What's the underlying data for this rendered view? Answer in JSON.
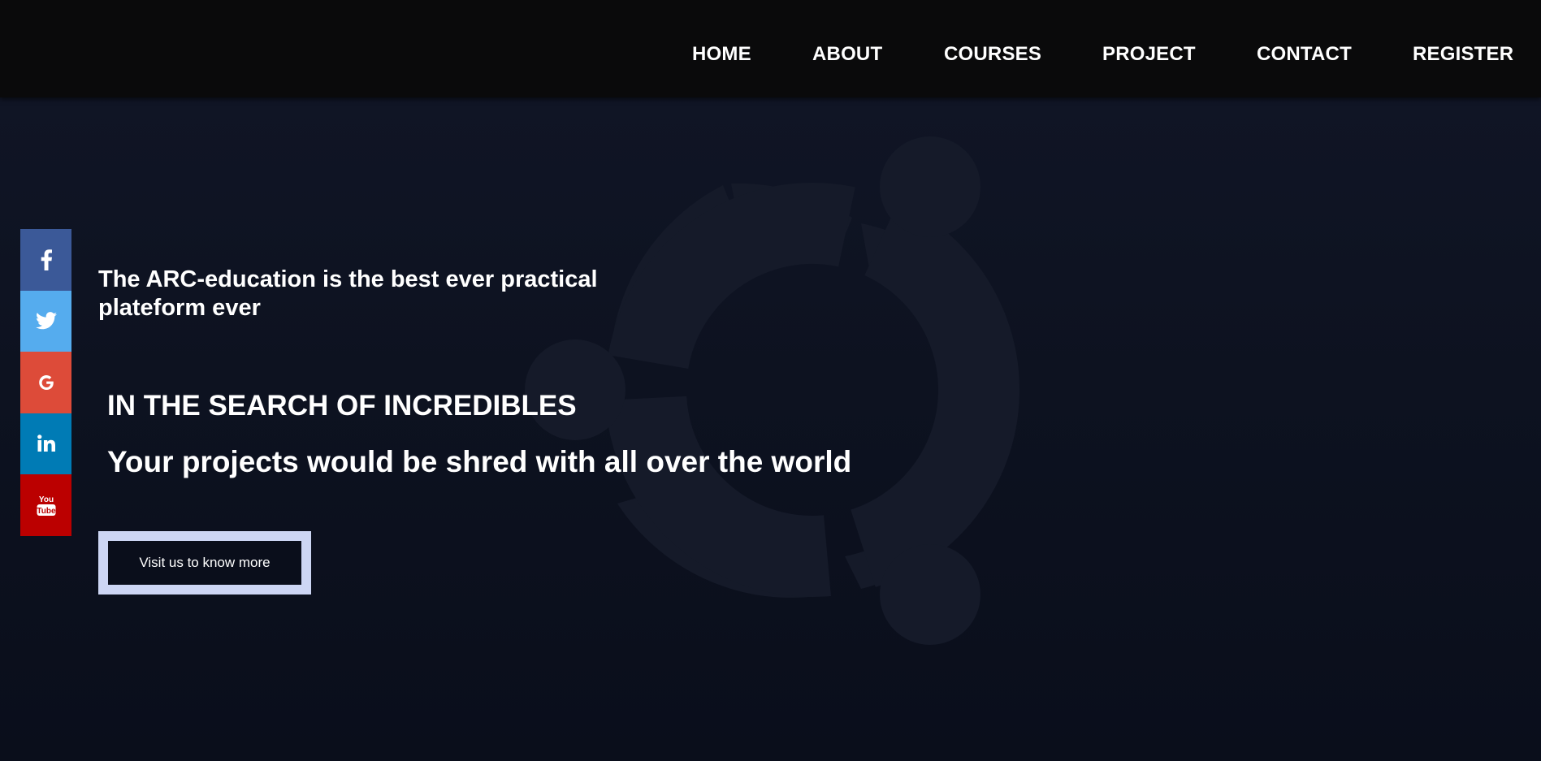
{
  "nav": {
    "items": [
      {
        "label": "HOME",
        "key": "home"
      },
      {
        "label": "ABOUT",
        "key": "about"
      },
      {
        "label": "COURSES",
        "key": "courses"
      },
      {
        "label": "PROJECT",
        "key": "project"
      },
      {
        "label": "CONTACT",
        "key": "contact"
      },
      {
        "label": "REGISTER",
        "key": "register"
      }
    ]
  },
  "social": {
    "items": [
      {
        "name": "facebook",
        "icon": "facebook-icon",
        "color": "#3b5998"
      },
      {
        "name": "twitter",
        "icon": "twitter-icon",
        "color": "#55acee"
      },
      {
        "name": "google",
        "icon": "google-icon",
        "color": "#dd4b39"
      },
      {
        "name": "linkedin",
        "icon": "linkedin-icon",
        "color": "#007bb5"
      },
      {
        "name": "youtube",
        "icon": "youtube-icon",
        "color": "#bb0000",
        "icon_text_top": "You",
        "icon_text_bottom": "Tube"
      }
    ]
  },
  "hero": {
    "tagline": "The ARC-education is the best ever practical plateform ever",
    "headline": "IN THE SEARCH OF INCREDIBLES",
    "subheadline": "Your projects would be shred with all over the world",
    "cta_label": "Visit us to know more"
  },
  "colors": {
    "header_bg": "#0a0a0b",
    "page_bg": "#0d1220",
    "cta_border": "#cdd6f4",
    "emblem": "#1a1f2e"
  }
}
